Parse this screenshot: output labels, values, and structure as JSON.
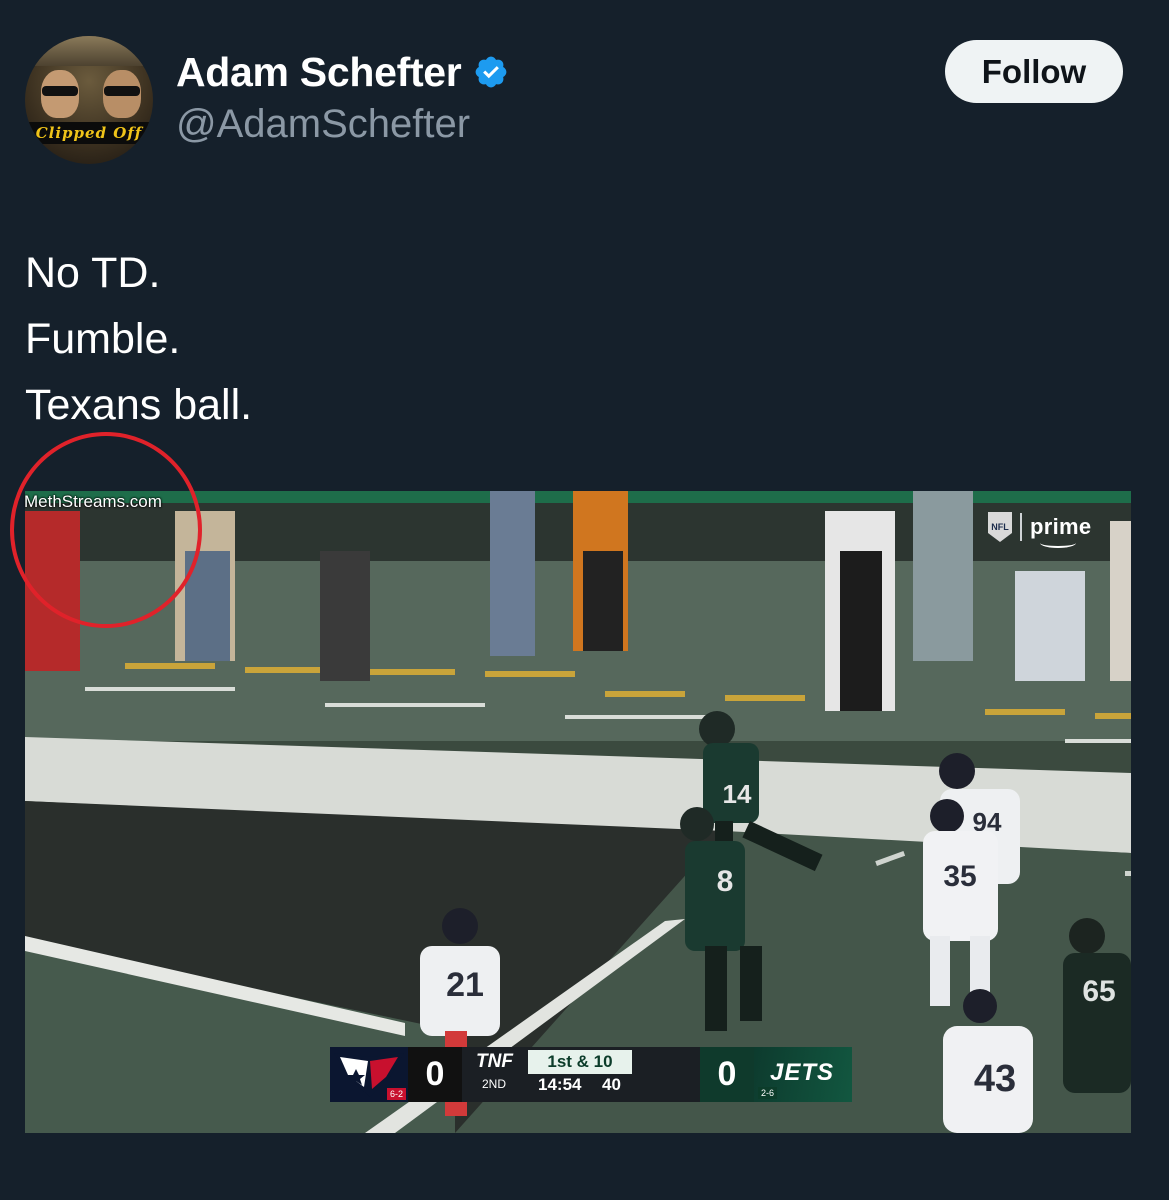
{
  "author": {
    "display_name": "Adam Schefter",
    "handle": "@AdamSchefter",
    "verified": true,
    "avatar_banner_text": "Clipped Off"
  },
  "actions": {
    "follow_label": "Follow"
  },
  "tweet": {
    "lines": [
      "No TD.",
      "Fumble.",
      "Texans ball."
    ]
  },
  "media": {
    "watermark": "MethStreams.com",
    "broadcaster": "prime",
    "league_badge": "NFL",
    "jersey_numbers": [
      "14",
      "8",
      "94",
      "35",
      "21",
      "43",
      "65"
    ],
    "scoreboard": {
      "home_team_record": "6-2",
      "home_score": "0",
      "show_label": "TNF",
      "quarter": "2ND",
      "down_distance": "1st & 10",
      "game_clock": "14:54",
      "play_clock": "40",
      "away_score": "0",
      "away_team_name": "JETS",
      "away_team_record": "2-6"
    }
  },
  "colors": {
    "background": "#15202b",
    "verified_blue": "#1d9bf0",
    "follow_bg": "#eff3f4",
    "handle_gray": "#8b98a5",
    "annotation_red": "#e0222a"
  },
  "icons": {
    "verified": "verified-badge-icon",
    "nfl": "nfl-shield-icon"
  }
}
